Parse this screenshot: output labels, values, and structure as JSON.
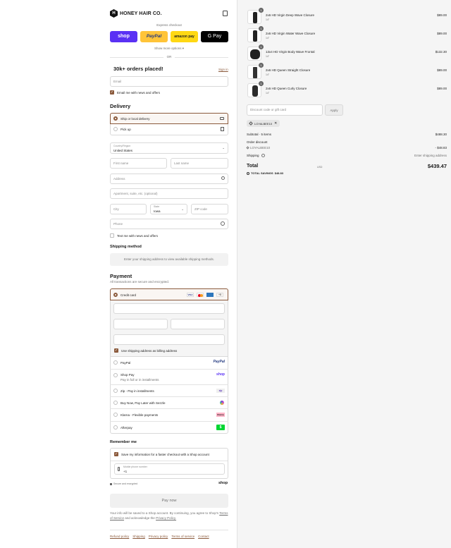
{
  "brand": {
    "name": "HONEY HAIR CO.",
    "logo_letter": "H"
  },
  "express": {
    "label": "Express checkout",
    "buttons": [
      "shop",
      "PayPal",
      "amazon pay",
      "G Pay"
    ],
    "more": "Show more options ▾",
    "or": "OR"
  },
  "promo": {
    "title": "30k+ orders placed!",
    "signin": "Sign in"
  },
  "contact": {
    "email_placeholder": "Email",
    "email_news": "Email me with news and offers"
  },
  "delivery": {
    "title": "Delivery",
    "ship_option": "Ship or local delivery",
    "pickup_option": "Pick up",
    "country_label": "Country/Region",
    "country_value": "United States",
    "first_name": "First name",
    "last_name": "Last name",
    "address": "Address",
    "apartment": "Apartment, suite, etc. (optional)",
    "city": "City",
    "state_label": "State",
    "state_value": "Iowa",
    "zip": "ZIP code",
    "phone": "Phone",
    "text_news": "Text me with news and offers"
  },
  "shipping_method": {
    "title": "Shipping method",
    "message": "Enter your shipping address to view available shipping methods."
  },
  "payment": {
    "title": "Payment",
    "subtitle": "All transactions are secure and encrypted.",
    "credit_card": "Credit card",
    "card_more": "+5",
    "billing_same": "Use shipping address as billing address",
    "options": [
      {
        "label": "PayPal",
        "sub": "",
        "logo": "PayPal"
      },
      {
        "label": "Shop Pay",
        "sub": "Pay in full or in installments",
        "logo": "shop"
      },
      {
        "label": "Zip - Pay in installments",
        "sub": "",
        "logo": "zip"
      },
      {
        "label": "Buy Now, Pay Later with Sezzle",
        "sub": "",
        "logo": ""
      },
      {
        "label": "Klarna - Flexible payments",
        "sub": "",
        "logo": "Klarna"
      },
      {
        "label": "Afterpay",
        "sub": "",
        "logo": "$"
      }
    ]
  },
  "remember": {
    "title": "Remember me",
    "save_info": "Save my information for a faster checkout with a Shop account",
    "mobile_label": "Mobile phone number",
    "mobile_value": "+1",
    "secure": "Secure and encrypted",
    "shop_logo": "shop"
  },
  "pay_now": "Pay now",
  "terms": {
    "line1": "Your info will be saved to a Shop account. By continuing, you agree to Shop's",
    "tos": "Terms of Service",
    "and": "and acknowledge the",
    "privacy": "Privacy Policy."
  },
  "footer_links": [
    "Refund policy",
    "Shipping",
    "Privacy policy",
    "Terms of service",
    "Contact"
  ],
  "cart": {
    "items": [
      {
        "name": "2x6 HD Virgin Deep Wave Closure",
        "variant": "14\"",
        "price": "$89.00",
        "qty": "1"
      },
      {
        "name": "2x6 HD Virgin Water Wave Closure",
        "variant": "14\"",
        "price": "$89.00",
        "qty": "1"
      },
      {
        "name": "13x4 HD Virgin Body Wave Frontal",
        "variant": "14\"",
        "price": "$132.30",
        "qty": "1"
      },
      {
        "name": "2x6 HD Queen Straight Closure",
        "variant": "14\"",
        "price": "$89.00",
        "qty": "1"
      },
      {
        "name": "2x6 HD Queen Curly Closure",
        "variant": "14\"",
        "price": "$89.00",
        "qty": "1"
      }
    ],
    "discount_placeholder": "Discount code or gift card",
    "apply": "Apply",
    "code_tag": "LOYALBEE10",
    "subtotal_label": "Subtotal · 5 items",
    "subtotal_value": "$488.30",
    "order_discount": "Order discount",
    "discount_code": "LOYALBEE10",
    "discount_value": "- $48.83",
    "shipping_label": "Shipping",
    "shipping_value": "Enter shipping address",
    "total_label": "Total",
    "currency": "USD",
    "total_value": "$439.47",
    "savings_label": "TOTAL SAVINGS",
    "savings_value": "$48.83"
  }
}
